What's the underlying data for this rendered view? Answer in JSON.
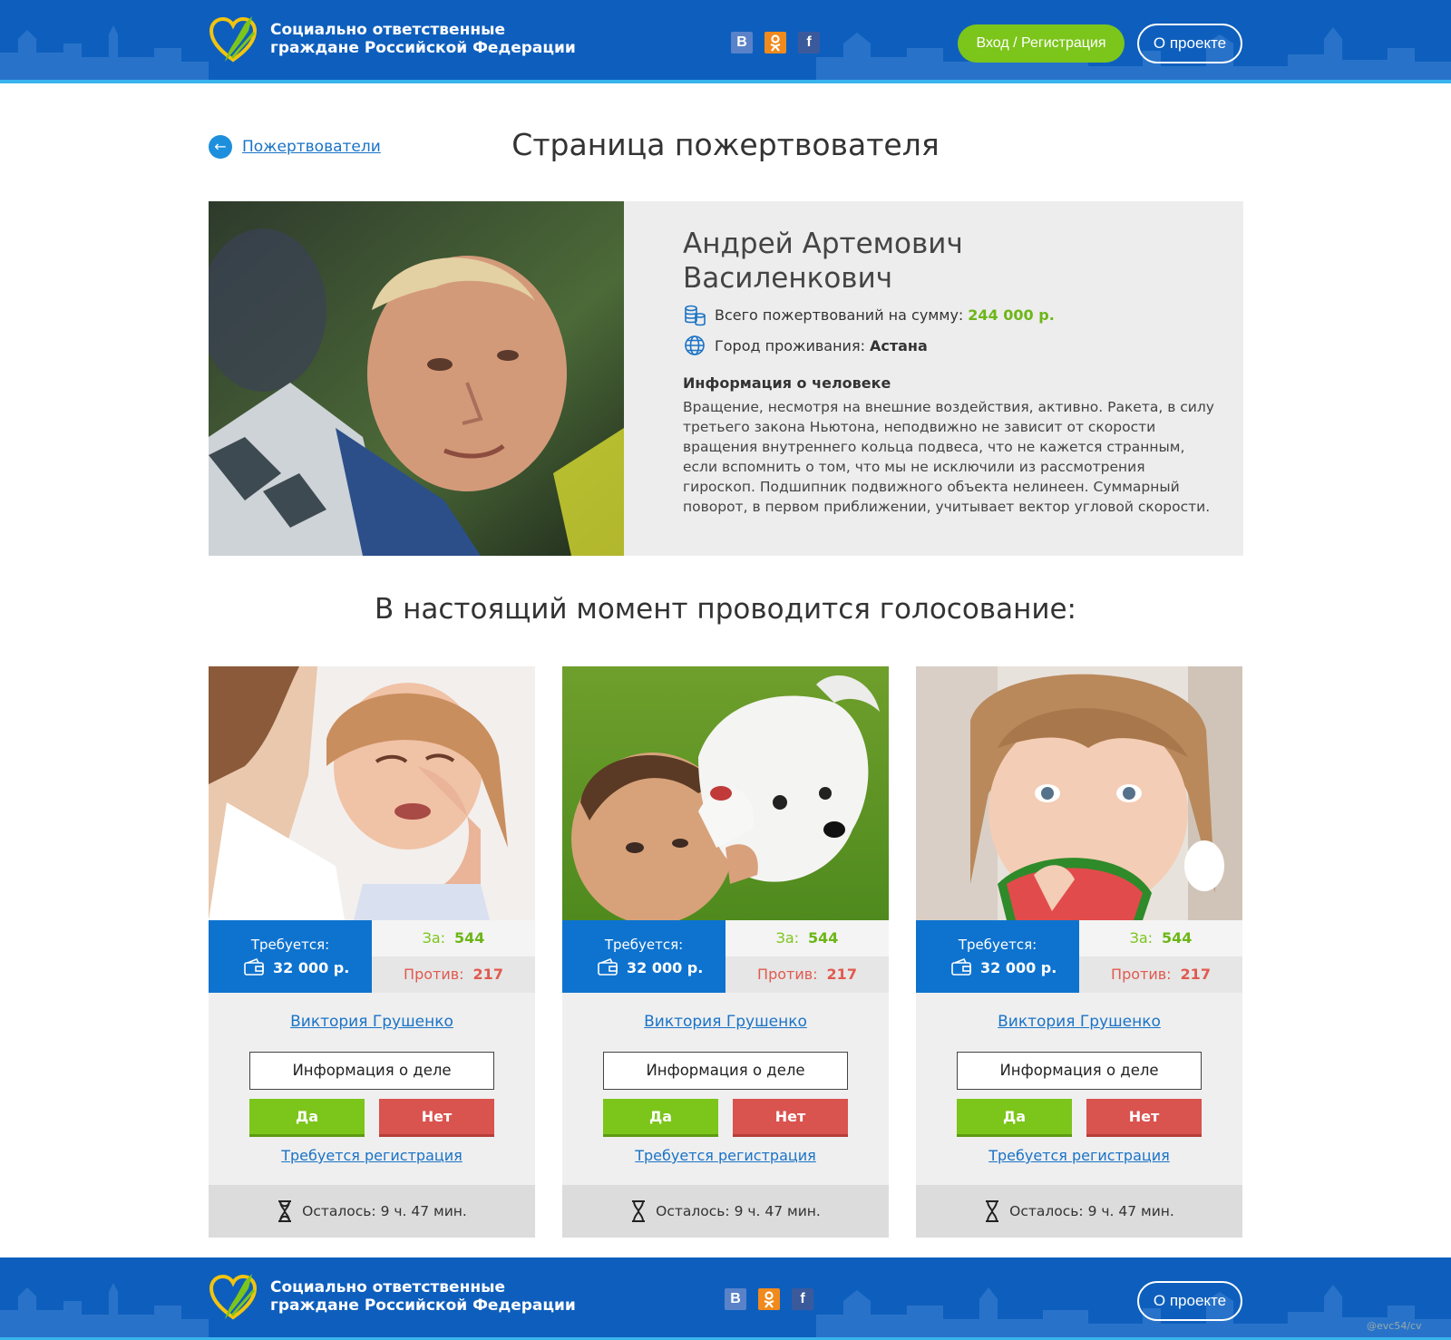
{
  "brand": {
    "line1": "Социально ответственные",
    "line2": "граждане Российской Федерации"
  },
  "socials": [
    {
      "name": "vk-icon",
      "glyph": "B"
    },
    {
      "name": "ok-icon",
      "glyph": "ok"
    },
    {
      "name": "facebook-icon",
      "glyph": "f"
    }
  ],
  "header": {
    "login_label": "Вход / Регистрация",
    "about_label": "О проекте"
  },
  "breadcrumb": {
    "back_label": "Пожертвователи"
  },
  "page_title": "Страница пожертвователя",
  "donor": {
    "name_line1": "Андрей Артемович",
    "name_line2": "Василенкович",
    "donations_label": "Всего пожертвований на сумму:",
    "donations_value": "244 000 р.",
    "city_label": "Город проживания:",
    "city_value": "Астана",
    "info_heading": "Информация о человеке",
    "info_text": "Вращение, несмотря на внешние воздействия, активно. Ракета, в силу третьего закона Ньютона, неподвижно не зависит от скорости вращения внутреннего кольца подвеса, что не кажется странным, если вспомнить о том, что мы не исключили из рассмотрения гироскоп. Подшипник подвижного объекта нелинеен. Суммарный поворот, в первом приближении, учитывает вектор угловой скорости."
  },
  "voting": {
    "section_title": "В настоящий момент проводится голосование:",
    "cards": [
      {
        "need_label": "Требуется:",
        "need_sum": "32 000 р.",
        "for_label": "За:",
        "for_value": "544",
        "against_label": "Против:",
        "against_value": "217",
        "author": "Виктория Грушенко",
        "info_button": "Информация о деле",
        "yes_button": "Да",
        "no_button": "Нет",
        "register_link": "Требуется регистрация",
        "timer": "Осталось: 9 ч. 47 мин."
      },
      {
        "need_label": "Требуется:",
        "need_sum": "32 000 р.",
        "for_label": "За:",
        "for_value": "544",
        "against_label": "Против:",
        "against_value": "217",
        "author": "Виктория Грушенко",
        "info_button": "Информация о деле",
        "yes_button": "Да",
        "no_button": "Нет",
        "register_link": "Требуется регистрация",
        "timer": "Осталось: 9 ч. 47 мин."
      },
      {
        "need_label": "Требуется:",
        "need_sum": "32 000 р.",
        "for_label": "За:",
        "for_value": "544",
        "against_label": "Против:",
        "against_value": "217",
        "author": "Виктория Грушенко",
        "info_button": "Информация о деле",
        "yes_button": "Да",
        "no_button": "Нет",
        "register_link": "Требуется регистрация",
        "timer": "Осталось: 9 ч. 47 мин."
      }
    ]
  },
  "footer": {
    "about_label": "О проекте"
  },
  "watermark": "@evc54/cv",
  "colors": {
    "header_blue": "#0e5fbd",
    "accent_green": "#7cc51b",
    "danger_red": "#d9534f",
    "link_blue": "#1a73c7",
    "need_blue": "#0e73cf"
  }
}
